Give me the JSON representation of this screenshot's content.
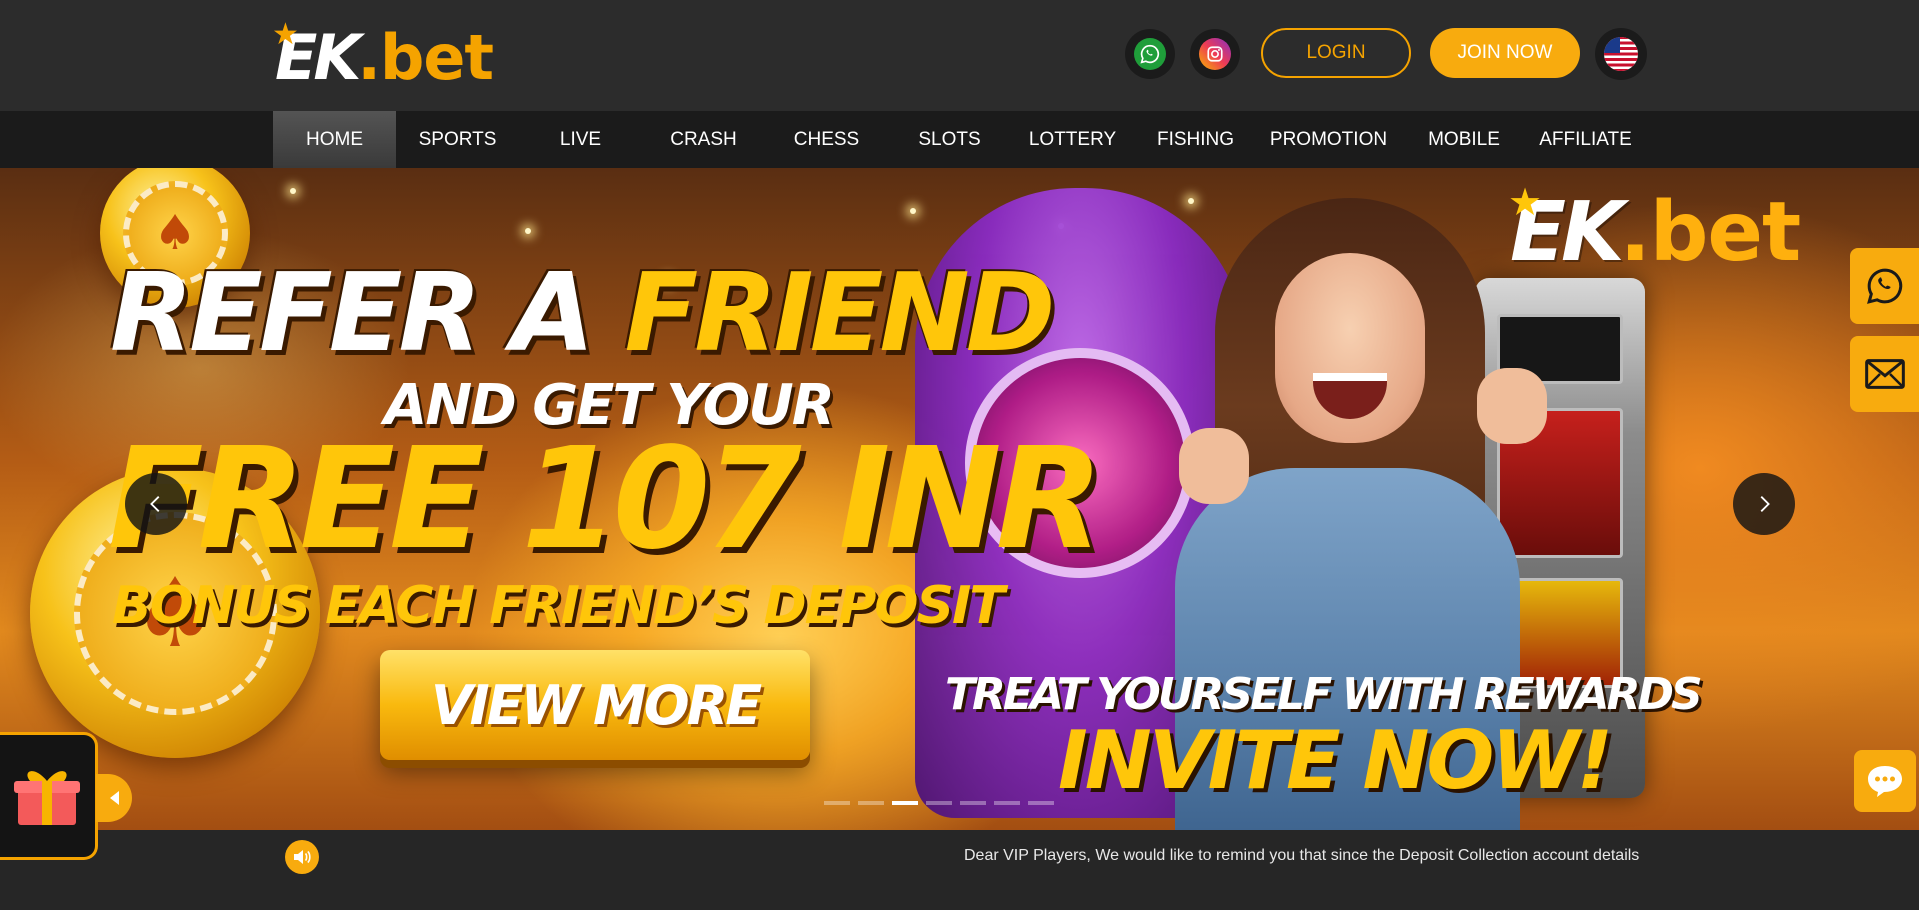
{
  "brand": {
    "logo_main": "EK",
    "logo_suffix": ".bet"
  },
  "header": {
    "social": [
      {
        "name": "whatsapp-icon",
        "color": "#1f9e3a"
      },
      {
        "name": "instagram-icon",
        "color": "#ee3b55"
      }
    ],
    "login_label": "LOGIN",
    "join_label": "JOIN NOW",
    "language_icon": "us-flag-icon"
  },
  "nav": {
    "items": [
      "HOME",
      "SPORTS",
      "LIVE",
      "CRASH",
      "CHESS",
      "SLOTS",
      "LOTTERY",
      "FISHING",
      "PROMOTION",
      "MOBILE",
      "AFFILIATE"
    ],
    "active": "HOME"
  },
  "banner": {
    "line1_white": "REFER A",
    "line1_yellow": "FRIEND",
    "line2": "AND GET YOUR",
    "line3": "FREE 107 INR",
    "line4": "BONUS EACH FRIEND’S DEPOSIT",
    "cta": "VIEW MORE",
    "tagline": "TREAT YOURSELF WITH REWARDS",
    "invite": "INVITE  NOW!",
    "logo_main": "EK",
    "logo_suffix": ".bet",
    "slide_count": 7,
    "active_slide": 3
  },
  "side_contact": [
    "whatsapp-icon",
    "mail-icon"
  ],
  "marquee": {
    "text": "Dear VIP Players, We would like to remind you that since the Deposit Collection account details"
  },
  "colors": {
    "accent": "#f8ab0e",
    "header_bg": "#2c2c2c",
    "nav_bg": "#1b1b1b",
    "banner_yellow": "#ffc60a"
  }
}
